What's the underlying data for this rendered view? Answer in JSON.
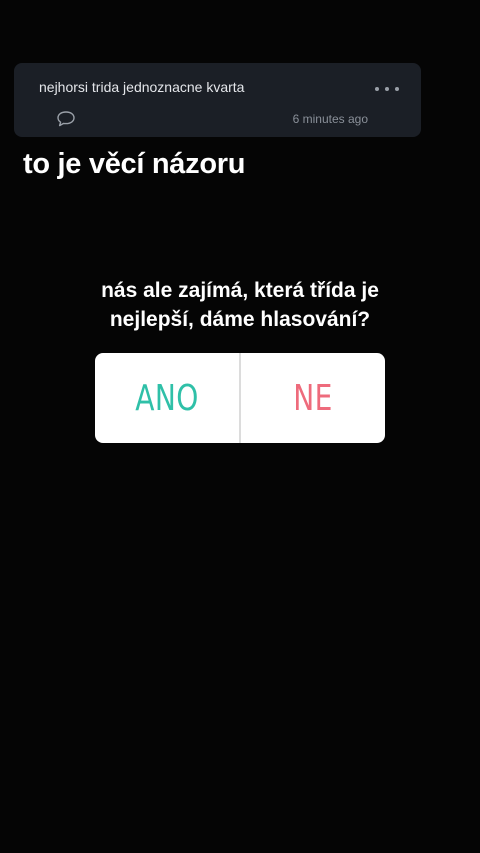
{
  "comment": {
    "text": "nejhorsi trida jednoznacne kvarta",
    "timestamp": "6 minutes ago",
    "more_icon": "ellipsis-icon",
    "reply_icon": "speech-bubble-icon"
  },
  "headline": "to je věcí názoru",
  "question": {
    "line1": "nás ale zajímá, která třída je",
    "line2": "nejlepší, dáme hlasování?"
  },
  "poll": {
    "option_yes": "ANO",
    "option_no": "NE",
    "yes_color": "#2fc0a8",
    "no_color": "#ee6b7c"
  },
  "colors": {
    "background": "#050505",
    "card": "#1b1f26"
  }
}
